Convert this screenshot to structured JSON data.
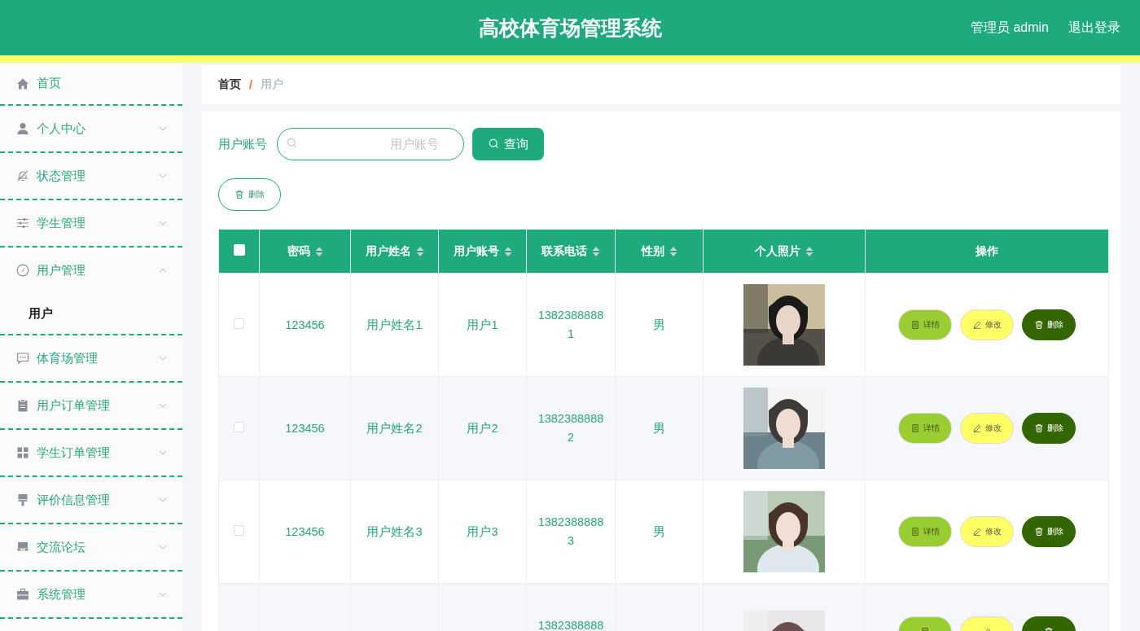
{
  "header": {
    "title": "高校体育场管理系统",
    "user": "管理员 admin",
    "logout": "退出登录"
  },
  "sidebar": {
    "items": [
      {
        "label": "首页",
        "expandable": false,
        "expanded": false
      },
      {
        "label": "个人中心",
        "expandable": true,
        "expanded": false
      },
      {
        "label": "状态管理",
        "expandable": true,
        "expanded": false
      },
      {
        "label": "学生管理",
        "expandable": true,
        "expanded": false
      },
      {
        "label": "用户管理",
        "expandable": true,
        "expanded": true,
        "children": [
          {
            "label": "用户",
            "selected": true
          }
        ]
      },
      {
        "label": "体育场管理",
        "expandable": true,
        "expanded": false
      },
      {
        "label": "用户订单管理",
        "expandable": true,
        "expanded": false
      },
      {
        "label": "学生订单管理",
        "expandable": true,
        "expanded": false
      },
      {
        "label": "评价信息管理",
        "expandable": true,
        "expanded": false
      },
      {
        "label": "交流论坛",
        "expandable": true,
        "expanded": false
      },
      {
        "label": "系统管理",
        "expandable": true,
        "expanded": false
      }
    ]
  },
  "breadcrumb": {
    "separator": "/",
    "items": [
      {
        "label": "首页",
        "current": false
      },
      {
        "label": "用户",
        "current": true
      }
    ]
  },
  "search": {
    "label": "用户账号",
    "placeholder": "用户账号",
    "button": "查询"
  },
  "toolbar": {
    "delete_button": "删除"
  },
  "table": {
    "columns": [
      {
        "kind": "checkbox",
        "checked": false
      },
      {
        "kind": "text",
        "label": "密码",
        "sortable": true
      },
      {
        "kind": "text",
        "label": "用户姓名",
        "sortable": true
      },
      {
        "kind": "text",
        "label": "用户账号",
        "sortable": true
      },
      {
        "kind": "text",
        "label": "联系电话",
        "sortable": true
      },
      {
        "kind": "text",
        "label": "性别",
        "sortable": true
      },
      {
        "kind": "text",
        "label": "个人照片",
        "sortable": true
      },
      {
        "kind": "text",
        "label": "操作",
        "sortable": false
      }
    ],
    "rows": [
      {
        "checked": false,
        "password": "123456",
        "name": "用户姓名1",
        "account": "用户1",
        "phone": "13823888881",
        "gender": "男",
        "photo": {
          "kind": "picture"
        },
        "actions": [
          {
            "kind": "detail",
            "label": "详情"
          },
          {
            "kind": "edit",
            "label": "修改"
          },
          {
            "kind": "delete",
            "label": "删除"
          }
        ]
      },
      {
        "checked": false,
        "password": "123456",
        "name": "用户姓名2",
        "account": "用户2",
        "phone": "13823888882",
        "gender": "男",
        "photo": {
          "kind": "picture"
        },
        "actions": [
          {
            "kind": "detail",
            "label": "详情"
          },
          {
            "kind": "edit",
            "label": "修改"
          },
          {
            "kind": "delete",
            "label": "删除"
          }
        ]
      },
      {
        "checked": false,
        "password": "123456",
        "name": "用户姓名3",
        "account": "用户3",
        "phone": "13823888883",
        "gender": "男",
        "photo": {
          "kind": "picture"
        },
        "actions": [
          {
            "kind": "detail",
            "label": "详情"
          },
          {
            "kind": "edit",
            "label": "修改"
          },
          {
            "kind": "delete",
            "label": "删除"
          }
        ]
      },
      {
        "phone": "1382388888",
        "photo": {
          "kind": "picture"
        },
        "actions": [
          {
            "kind": "detail"
          },
          {
            "kind": "edit"
          },
          {
            "kind": "delete"
          }
        ]
      }
    ]
  }
}
